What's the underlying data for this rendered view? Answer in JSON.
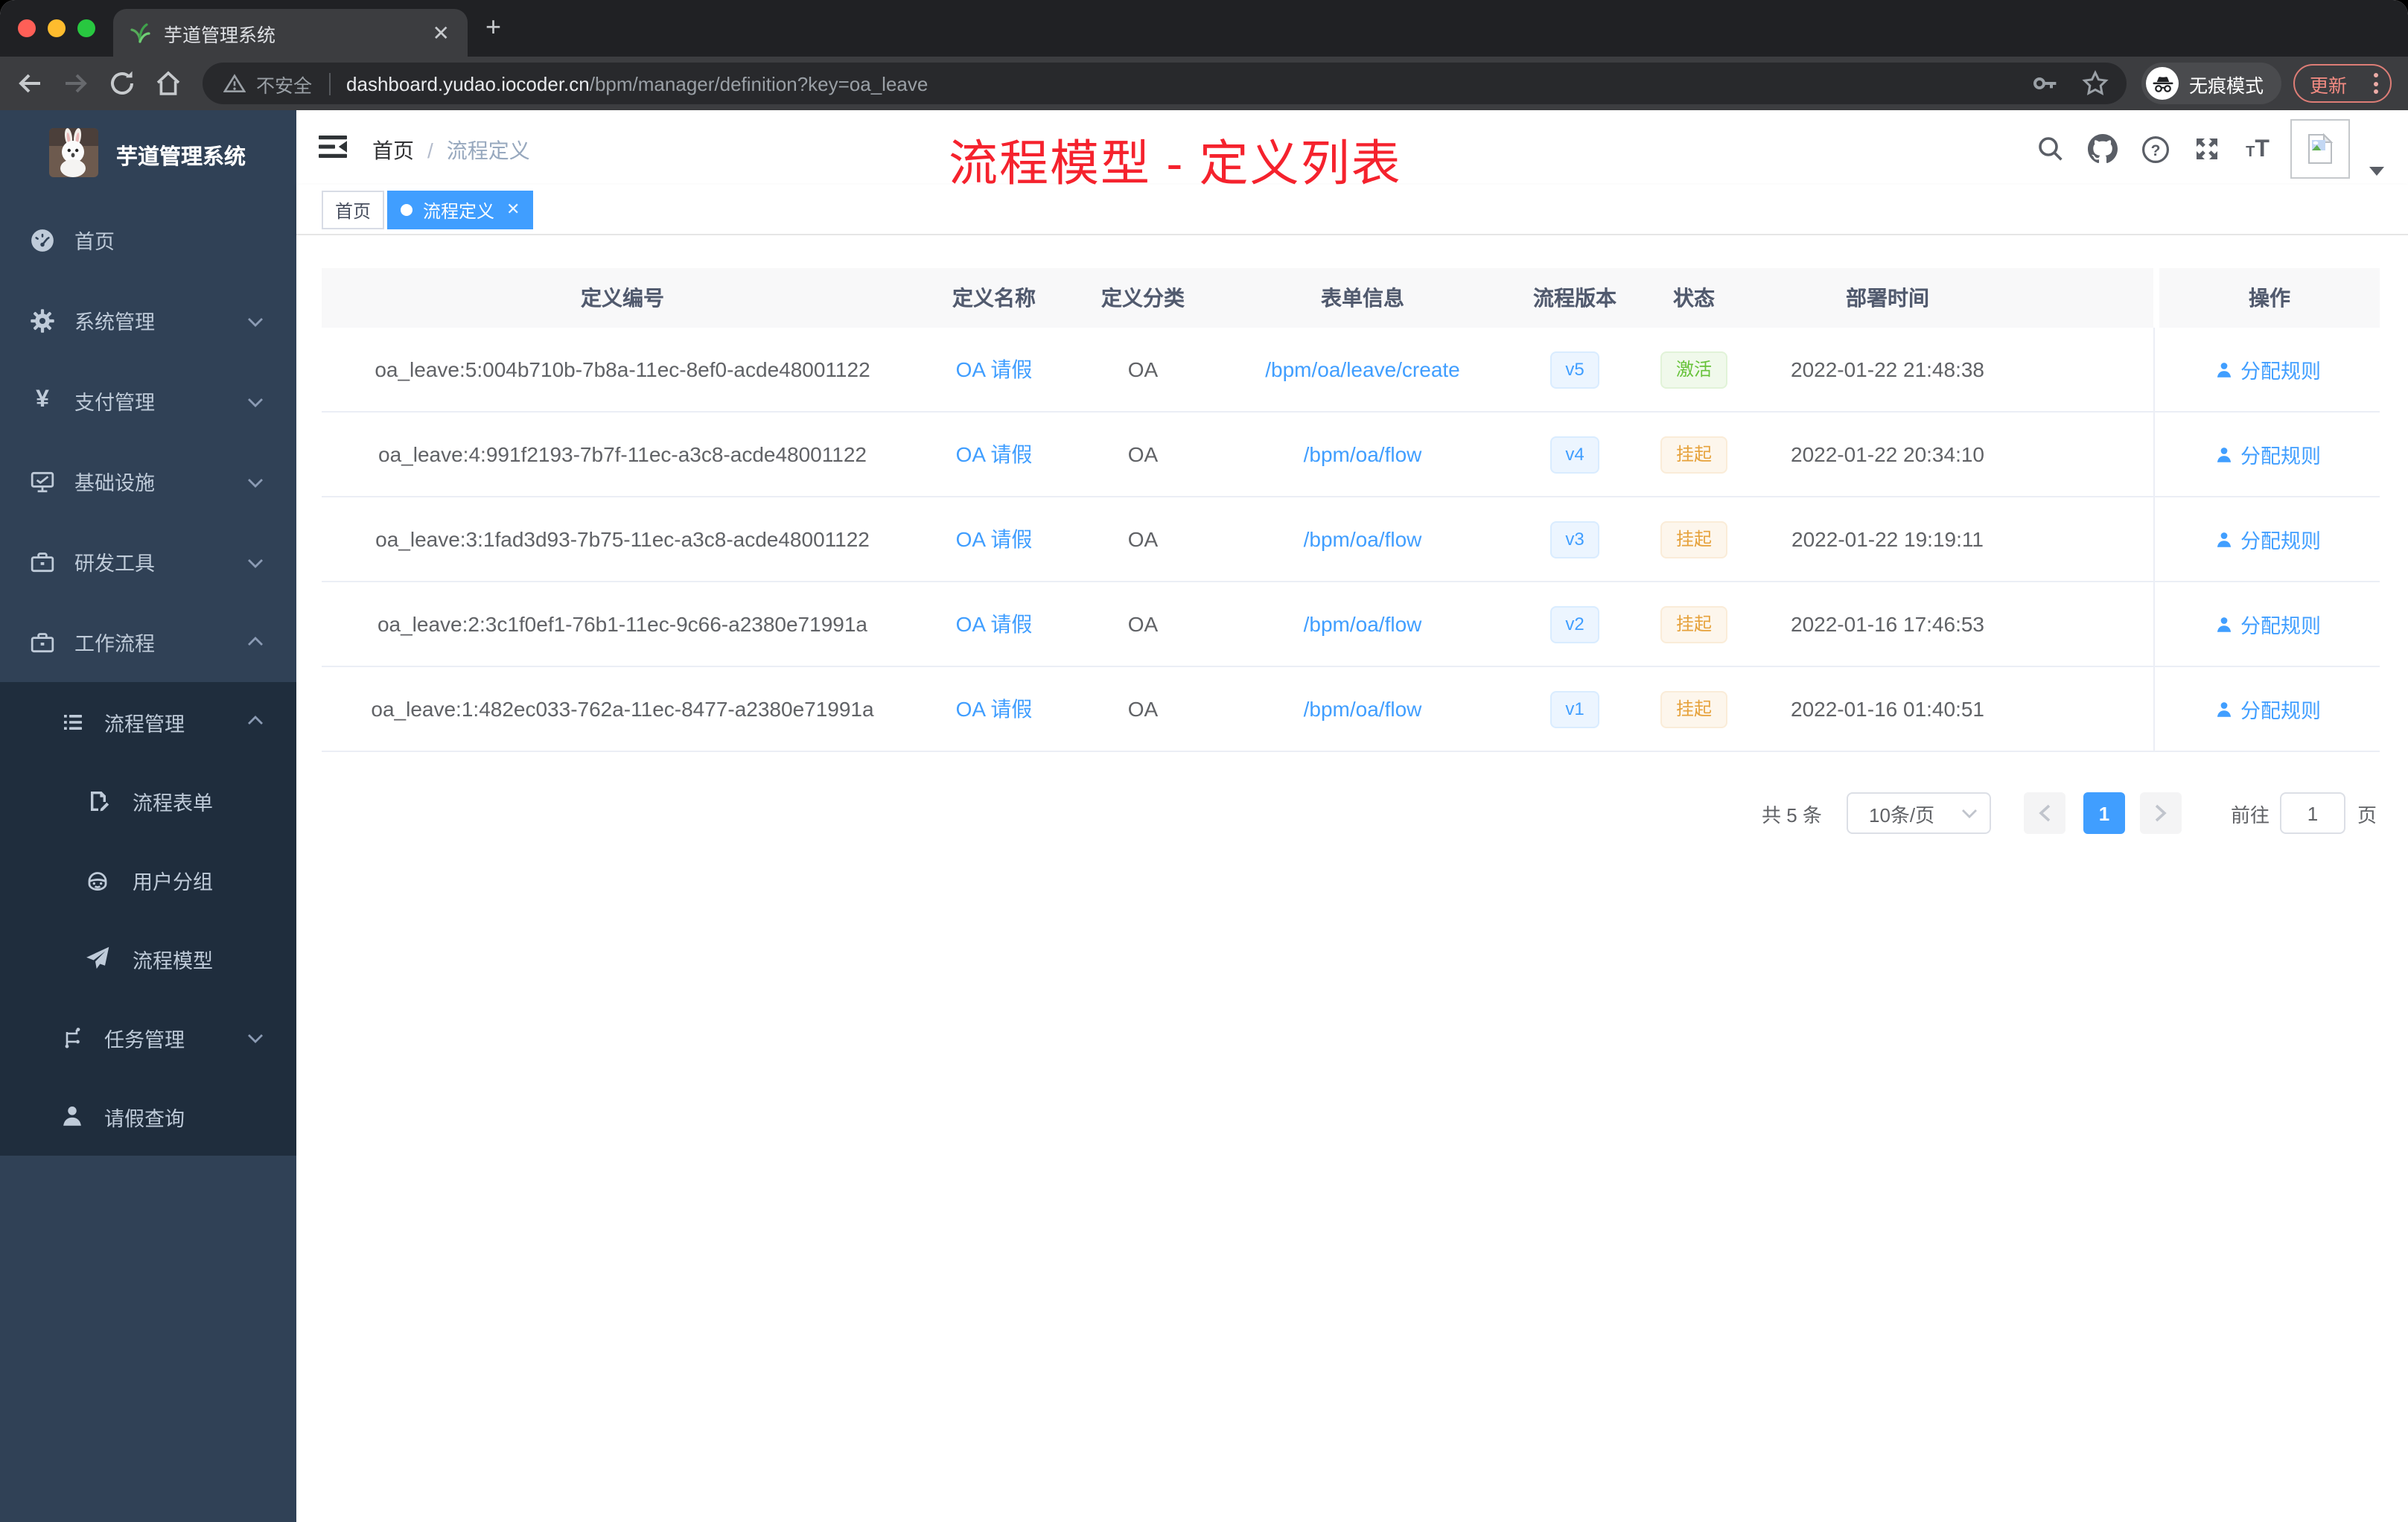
{
  "browser": {
    "tab_title": "芋道管理系统",
    "security_label": "不安全",
    "url_host": "dashboard.yudao.iocoder.cn",
    "url_path": "/bpm/manager/definition?key=oa_leave",
    "incognito_label": "无痕模式",
    "update_label": "更新"
  },
  "sidebar": {
    "app_title": "芋道管理系统",
    "menu": [
      {
        "label": "首页",
        "icon": "dashboard-icon"
      },
      {
        "label": "系统管理",
        "icon": "gear-icon",
        "chevron": "down"
      },
      {
        "label": "支付管理",
        "icon": "yen-icon",
        "chevron": "down"
      },
      {
        "label": "基础设施",
        "icon": "monitor-icon",
        "chevron": "down"
      },
      {
        "label": "研发工具",
        "icon": "toolbox-icon",
        "chevron": "down"
      },
      {
        "label": "工作流程",
        "icon": "briefcase-icon",
        "chevron": "up"
      },
      {
        "label": "流程管理",
        "icon": "list-icon",
        "chevron": "up"
      },
      {
        "label": "流程表单",
        "icon": "form-edit-icon"
      },
      {
        "label": "用户分组",
        "icon": "robot-icon"
      },
      {
        "label": "流程模型",
        "icon": "paper-plane-icon"
      },
      {
        "label": "任务管理",
        "icon": "tree-icon",
        "chevron": "down"
      },
      {
        "label": "请假查询",
        "icon": "user-icon"
      }
    ]
  },
  "breadcrumb": {
    "home": "首页",
    "separator": "/",
    "current": "流程定义"
  },
  "annotation": {
    "text": "流程模型 - 定义列表",
    "color": "#f5222d"
  },
  "tags": [
    {
      "label": "首页",
      "active": false
    },
    {
      "label": "流程定义",
      "active": true
    }
  ],
  "table": {
    "headers": [
      "定义编号",
      "定义名称",
      "定义分类",
      "表单信息",
      "流程版本",
      "状态",
      "部署时间",
      "操作"
    ],
    "rows": [
      {
        "id": "oa_leave:5:004b710b-7b8a-11ec-8ef0-acde48001122",
        "name": "OA 请假",
        "category": "OA",
        "form": "/bpm/oa/leave/create",
        "version": "v5",
        "status": "激活",
        "status_type": "success",
        "deploy_time": "2022-01-22 21:48:38",
        "action_label": "分配规则"
      },
      {
        "id": "oa_leave:4:991f2193-7b7f-11ec-a3c8-acde48001122",
        "name": "OA 请假",
        "category": "OA",
        "form": "/bpm/oa/flow",
        "version": "v4",
        "status": "挂起",
        "status_type": "warning",
        "deploy_time": "2022-01-22 20:34:10",
        "action_label": "分配规则"
      },
      {
        "id": "oa_leave:3:1fad3d93-7b75-11ec-a3c8-acde48001122",
        "name": "OA 请假",
        "category": "OA",
        "form": "/bpm/oa/flow",
        "version": "v3",
        "status": "挂起",
        "status_type": "warning",
        "deploy_time": "2022-01-22 19:19:11",
        "action_label": "分配规则"
      },
      {
        "id": "oa_leave:2:3c1f0ef1-76b1-11ec-9c66-a2380e71991a",
        "name": "OA 请假",
        "category": "OA",
        "form": "/bpm/oa/flow",
        "version": "v2",
        "status": "挂起",
        "status_type": "warning",
        "deploy_time": "2022-01-16 17:46:53",
        "action_label": "分配规则"
      },
      {
        "id": "oa_leave:1:482ec033-762a-11ec-8477-a2380e71991a",
        "name": "OA 请假",
        "category": "OA",
        "form": "/bpm/oa/flow",
        "version": "v1",
        "status": "挂起",
        "status_type": "warning",
        "deploy_time": "2022-01-16 01:40:51",
        "action_label": "分配规则"
      }
    ]
  },
  "pagination": {
    "total": "共 5 条",
    "page_size": "10条/页",
    "current": "1",
    "goto_label": "前往",
    "goto_value": "1",
    "page_unit": "页"
  },
  "colors": {
    "accent": "#409eff",
    "annotation_red": "#f5222d",
    "status_active": "#67c23a",
    "status_suspended": "#e6a23c",
    "sidebar_bg": "#304156",
    "submenu_bg": "#1f2d3d",
    "tag_active": "#409eff"
  }
}
